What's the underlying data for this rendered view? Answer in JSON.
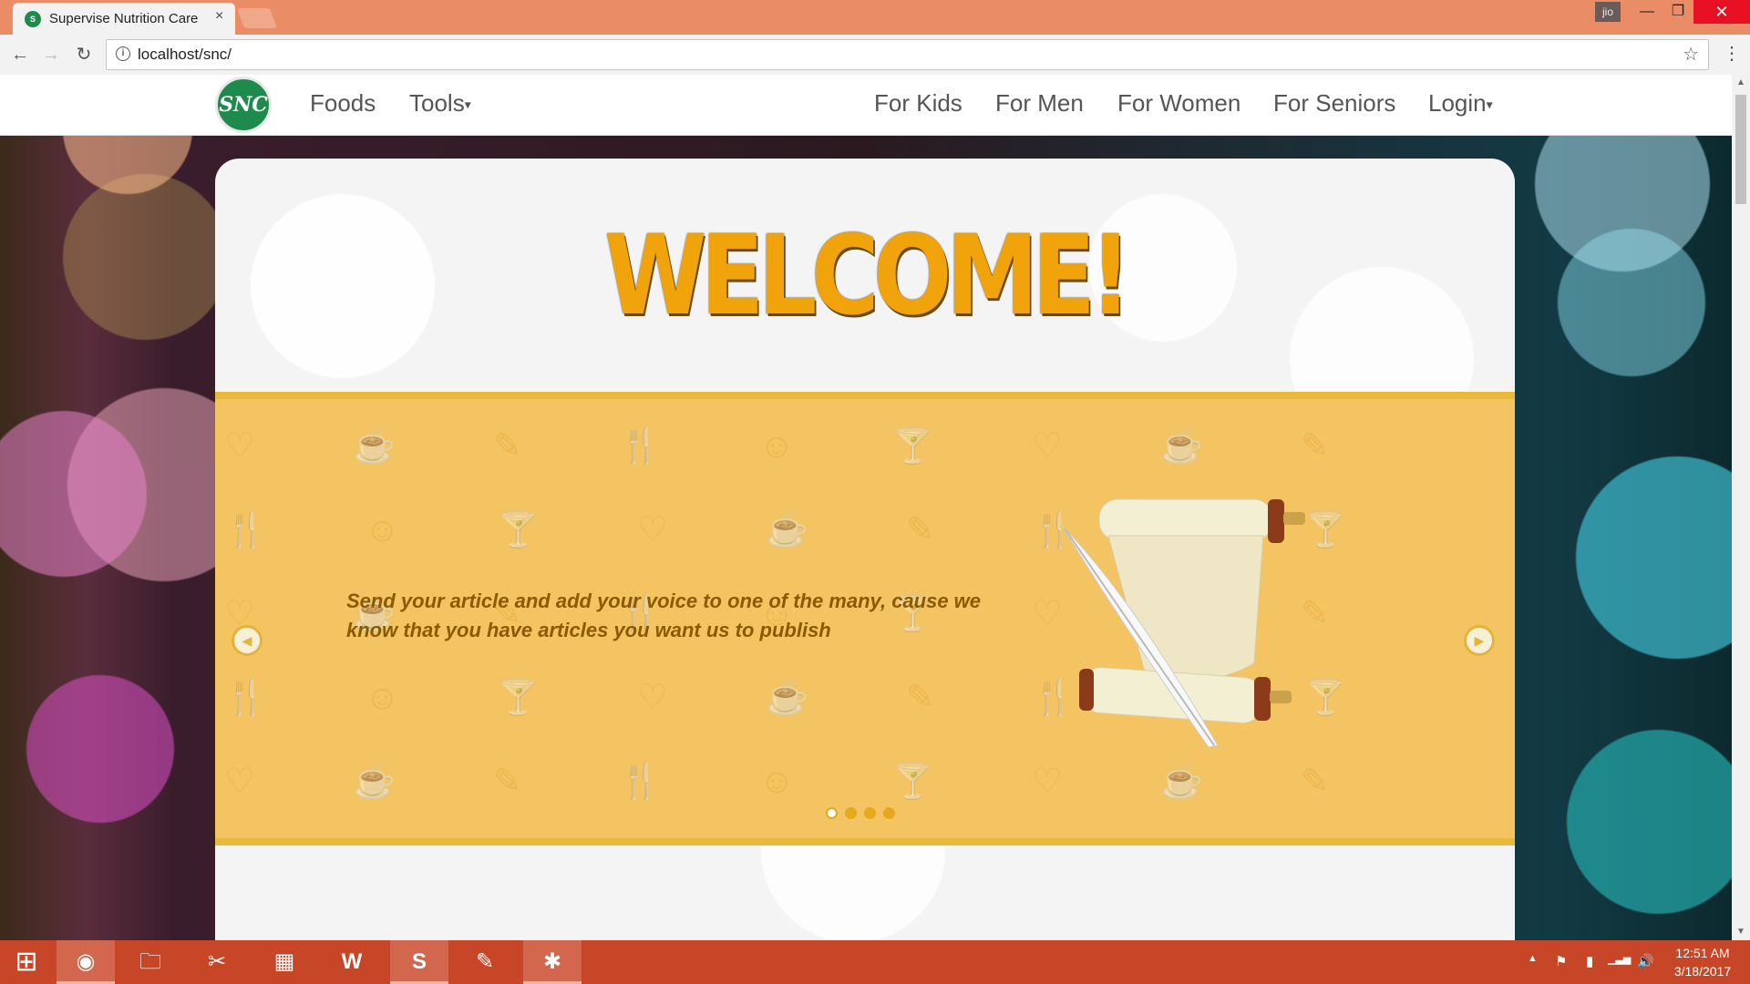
{
  "browser": {
    "tab_title": "Supervise Nutrition Care",
    "tab_close": "×",
    "user_badge": "jio",
    "url": "localhost/snc/",
    "info_glyph": "i",
    "star_glyph": "☆",
    "menu_glyph": "⋮",
    "back_glyph": "←",
    "forward_glyph": "→",
    "reload_glyph": "↻",
    "minimize_glyph": "—",
    "maximize_glyph": "❐",
    "close_glyph": "✕"
  },
  "site": {
    "logo_text": "SNC",
    "nav_left": [
      "Foods",
      "Tools"
    ],
    "nav_right": [
      "For Kids",
      "For Men",
      "For Women",
      "For Seniors",
      "Login"
    ],
    "caret": "▾",
    "welcome": "WELCOME!",
    "slide_text": "Send your article and add your voice to one of the many,  cause we know that you have articles you want us to publish",
    "prev_arrow": "◀",
    "next_arrow": "▶",
    "slide_count": 4,
    "active_slide": 1,
    "pattern_glyphs": "♡ ☕ ✎ 🍴 ☺ 🍸 ♡ ☕ ✎ 🍴 ☺ 🍸 ♡ ☕ ✎ 🍴 ☺ 🍸 ♡ ☕ ✎ 🍴 ☺ 🍸 ♡ ☕ ✎ 🍴 ☺ 🍸 ♡ ☕ ✎ 🍴 ☺ 🍸 ♡ ☕ ✎ 🍴 ☺ 🍸 ♡ ☕ ✎ 🍴 ☺ 🍸 ♡ ☕ ✎ 🍴 ☺ 🍸 ♡ ☕ ✎ 🍴"
  },
  "scrollbar": {
    "up": "▲",
    "down": "▼"
  },
  "taskbar": {
    "start_glyph": "⊞",
    "apps": [
      "chrome-icon",
      "file-explorer-icon",
      "snipping-tool-icon",
      "calculator-icon",
      "word-icon",
      "sublime-text-icon",
      "paint-icon",
      "xampp-icon"
    ],
    "app_glyphs": [
      "◉",
      "🗀",
      "✂",
      "▦",
      "W",
      "S",
      "✎",
      "✱"
    ],
    "tray_glyphs": [
      "▲",
      "⚑",
      "▮",
      "▁▃▅",
      "🔊"
    ],
    "time": "12:51 AM",
    "date": "3/18/2017"
  },
  "colors": {
    "titlebar": "#ea8c65",
    "banner": "#f4c462",
    "welcome": "#f0a30a",
    "taskbar": "#c84628",
    "logo_green": "#1e8a4c"
  }
}
